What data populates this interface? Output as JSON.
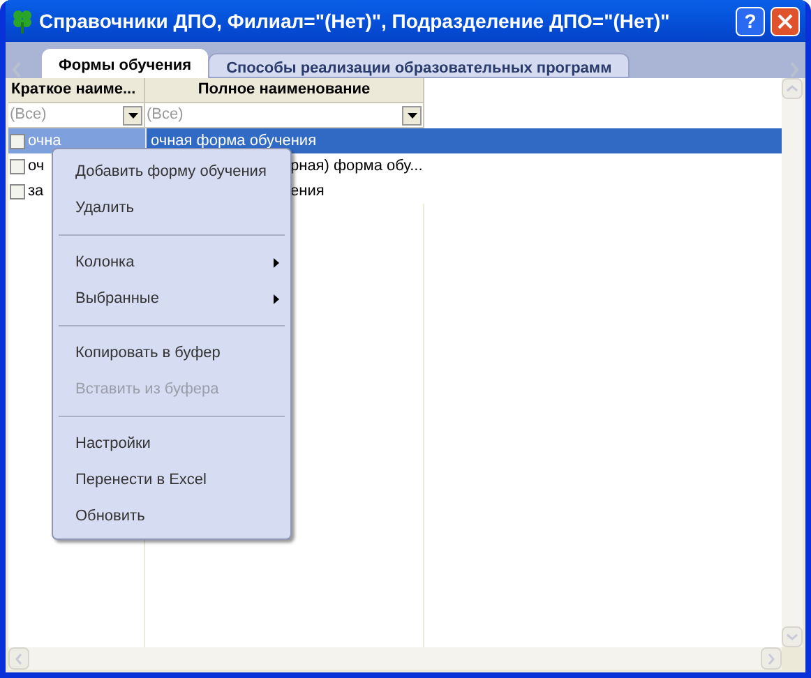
{
  "window": {
    "title": "Справочники ДПО, Филиал=\"(Нет)\", Подразделение ДПО=\"(Нет)\"",
    "help": "?"
  },
  "tabs": [
    {
      "label": "Формы обучения",
      "selected": true
    },
    {
      "label": "Способы реализации образовательных программ",
      "selected": false
    }
  ],
  "table": {
    "columns": [
      "Краткое наиме...",
      "Полное наименование"
    ],
    "filters": [
      "(Все)",
      "(Все)"
    ],
    "rows": [
      {
        "short": "очна",
        "full": "очная форма обучения",
        "selected": true,
        "checked": false,
        "covered": false
      },
      {
        "short": "оч",
        "full": "рная) форма обу...",
        "selected": false,
        "checked": false,
        "covered": true
      },
      {
        "short": "за",
        "full": "ения",
        "selected": false,
        "checked": false,
        "covered": true
      }
    ]
  },
  "context_menu": [
    {
      "kind": "item",
      "label": "Добавить форму обучения",
      "disabled": false,
      "submenu": false
    },
    {
      "kind": "item",
      "label": "Удалить",
      "disabled": false,
      "submenu": false
    },
    {
      "kind": "separator"
    },
    {
      "kind": "item",
      "label": "Колонка",
      "disabled": false,
      "submenu": true
    },
    {
      "kind": "item",
      "label": "Выбранные",
      "disabled": false,
      "submenu": true
    },
    {
      "kind": "separator"
    },
    {
      "kind": "item",
      "label": "Копировать в буфер",
      "disabled": false,
      "submenu": false
    },
    {
      "kind": "item",
      "label": "Вставить из буфера",
      "disabled": true,
      "submenu": false
    },
    {
      "kind": "separator"
    },
    {
      "kind": "item",
      "label": "Настройки",
      "disabled": false,
      "submenu": false
    },
    {
      "kind": "item",
      "label": "Перенести в Excel",
      "disabled": false,
      "submenu": false
    },
    {
      "kind": "item",
      "label": "Обновить",
      "disabled": false,
      "submenu": false
    }
  ]
}
